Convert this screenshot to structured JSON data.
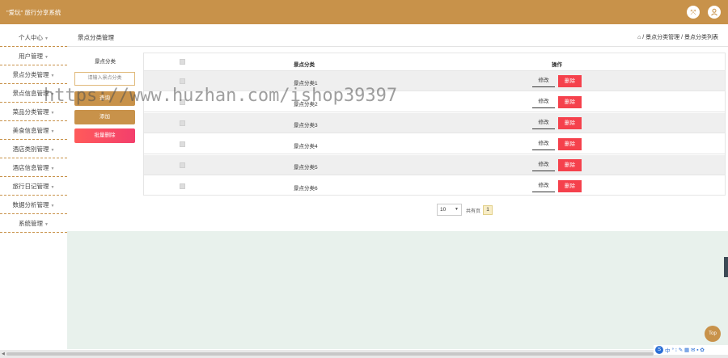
{
  "app": {
    "title": "\"爱玩\" 旅行分享系统"
  },
  "icons": {
    "switch": "shrink-arrows-icon",
    "user": "user-icon"
  },
  "sidebar": {
    "items": [
      {
        "label": "个人中心"
      },
      {
        "label": "用户管理"
      },
      {
        "label": "景点分类管理"
      },
      {
        "label": "景点信息管理"
      },
      {
        "label": "菜品分类管理"
      },
      {
        "label": "美食信息管理"
      },
      {
        "label": "酒店类别管理"
      },
      {
        "label": "酒店信息管理"
      },
      {
        "label": "旅行日记管理"
      },
      {
        "label": "数据分析管理"
      },
      {
        "label": "系统管理"
      }
    ]
  },
  "header": {
    "page_title": "景点分类管理",
    "breadcrumb": "⌂ / 景点分类管理 / 景点分类列表"
  },
  "search": {
    "label": "景点分类",
    "placeholder": "请输入景点分类",
    "query_label": "查询",
    "add_label": "添加",
    "batch_delete_label": "批量删除"
  },
  "table": {
    "headers": {
      "name": "景点分类",
      "operation": "操作"
    },
    "rows": [
      {
        "name": "景点分类1",
        "edit": "修改",
        "delete": "删除"
      },
      {
        "name": "景点分类2",
        "edit": "修改",
        "delete": "删除"
      },
      {
        "name": "景点分类3",
        "edit": "修改",
        "delete": "删除"
      },
      {
        "name": "景点分类4",
        "edit": "修改",
        "delete": "删除"
      },
      {
        "name": "景点分类5",
        "edit": "修改",
        "delete": "删除"
      },
      {
        "name": "景点分类6",
        "edit": "修改",
        "delete": "删除"
      }
    ]
  },
  "pagination": {
    "page_size": "10",
    "total_label": "共有页",
    "current_page": "1"
  },
  "floating": {
    "top_label": "Top"
  },
  "watermark": {
    "text": "https://www.huzhan.com/ishop39397"
  },
  "ime": {
    "logo": "S",
    "text": "中",
    "symbols": "° ⁝ ✎ ▦ ✉ ▪ ✿"
  },
  "colors": {
    "brand": "#c8924a",
    "danger": "#f5414c",
    "content_bg": "#e8f1ec"
  }
}
